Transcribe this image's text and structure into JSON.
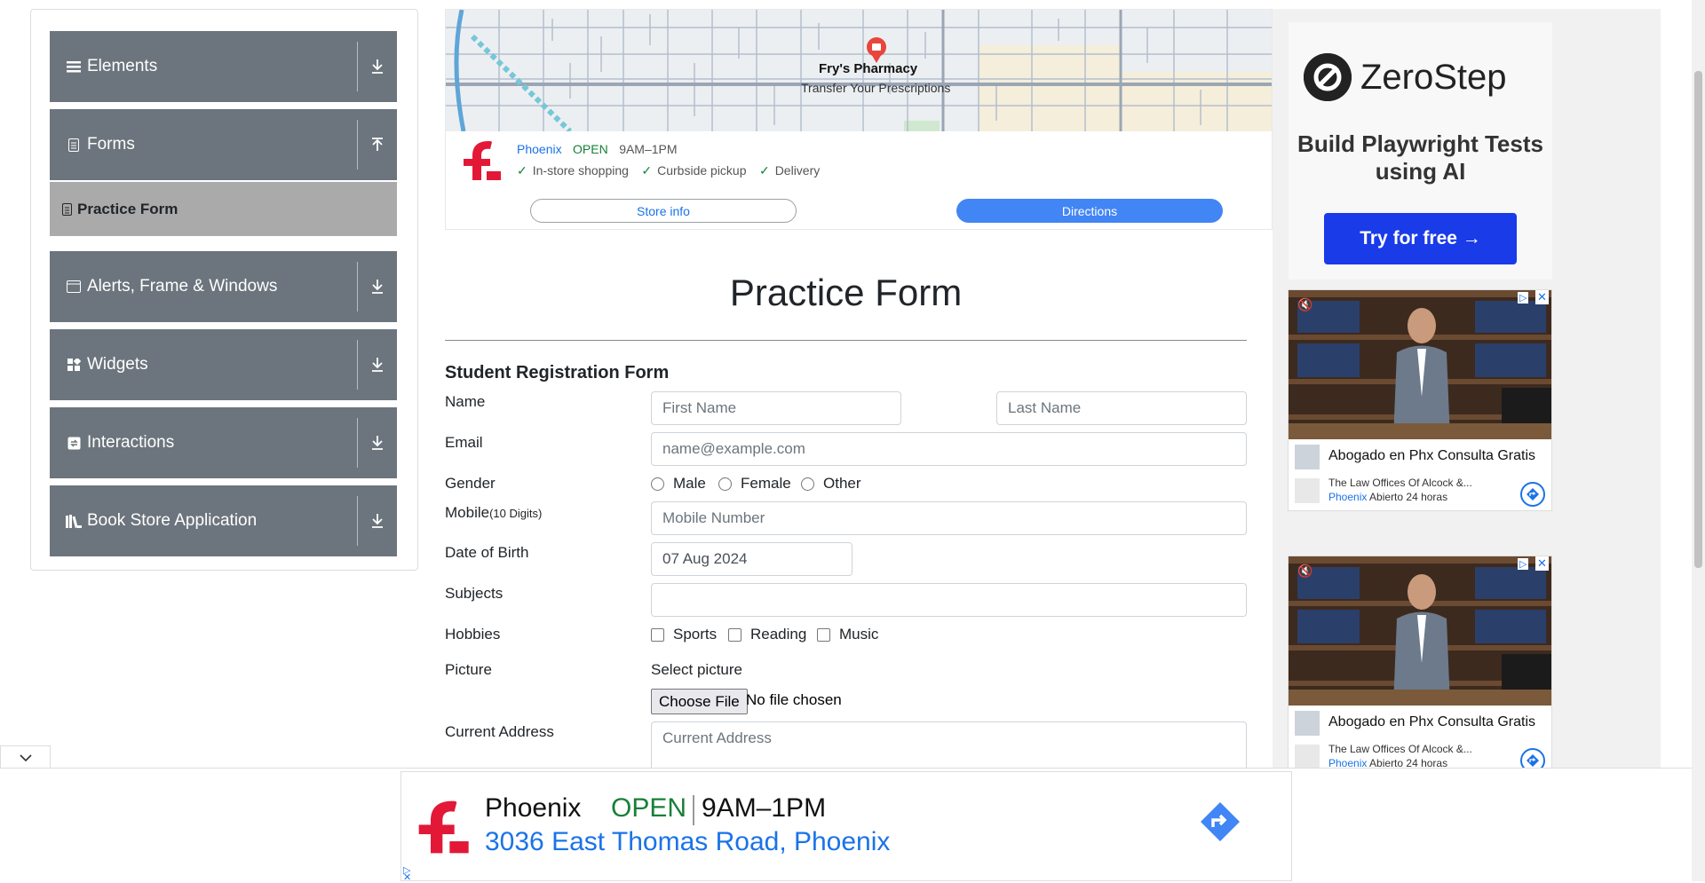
{
  "sidebar": {
    "groups": [
      {
        "label": "Elements"
      },
      {
        "label": "Forms"
      },
      {
        "label": "Alerts, Frame & Windows"
      },
      {
        "label": "Widgets"
      },
      {
        "label": "Interactions"
      },
      {
        "label": "Book Store Application"
      }
    ],
    "active_item": "Practice Form"
  },
  "map_ad": {
    "place": "Fry's Pharmacy",
    "place_sub": "Transfer Your Prescriptions",
    "city": "Phoenix",
    "open": "OPEN",
    "hours": "9AM–1PM",
    "features": [
      "In-store shopping",
      "Curbside pickup",
      "Delivery"
    ],
    "store_info": "Store info",
    "directions": "Directions"
  },
  "form": {
    "page_title": "Practice Form",
    "form_title": "Student Registration Form",
    "labels": {
      "name": "Name",
      "email": "Email",
      "gender": "Gender",
      "mobile": "Mobile",
      "mobile_hint": "(10 Digits)",
      "dob": "Date of Birth",
      "subjects": "Subjects",
      "hobbies": "Hobbies",
      "picture": "Picture",
      "address": "Current Address"
    },
    "placeholders": {
      "first_name": "First Name",
      "last_name": "Last Name",
      "email": "name@example.com",
      "mobile": "Mobile Number",
      "address": "Current Address"
    },
    "dob_value": "07 Aug 2024",
    "genders": [
      "Male",
      "Female",
      "Other"
    ],
    "hobbies": [
      "Sports",
      "Reading",
      "Music"
    ],
    "select_picture": "Select picture",
    "choose_file": "Choose File",
    "no_file": "No file chosen"
  },
  "right_ads": {
    "zerostep": {
      "brand": "ZeroStep",
      "tagline": "Build Playwright Tests using AI",
      "button": "Try for free →"
    },
    "video": {
      "title": "Abogado en Phx Consulta Gratis",
      "org": "The Law Offices Of Alcock &...",
      "city": "Phoenix",
      "status": "Abierto 24 horas"
    }
  },
  "bottom_ad": {
    "city": "Phoenix",
    "open": "OPEN",
    "hours": "9AM–1PM",
    "address": "3036 East Thomas Road, Phoenix"
  },
  "colors": {
    "sidebar_group": "#6c757d",
    "sidebar_active": "#aaaaaa",
    "link_blue": "#1a73e8",
    "open_green": "#188038",
    "brand_red": "#e31837"
  }
}
